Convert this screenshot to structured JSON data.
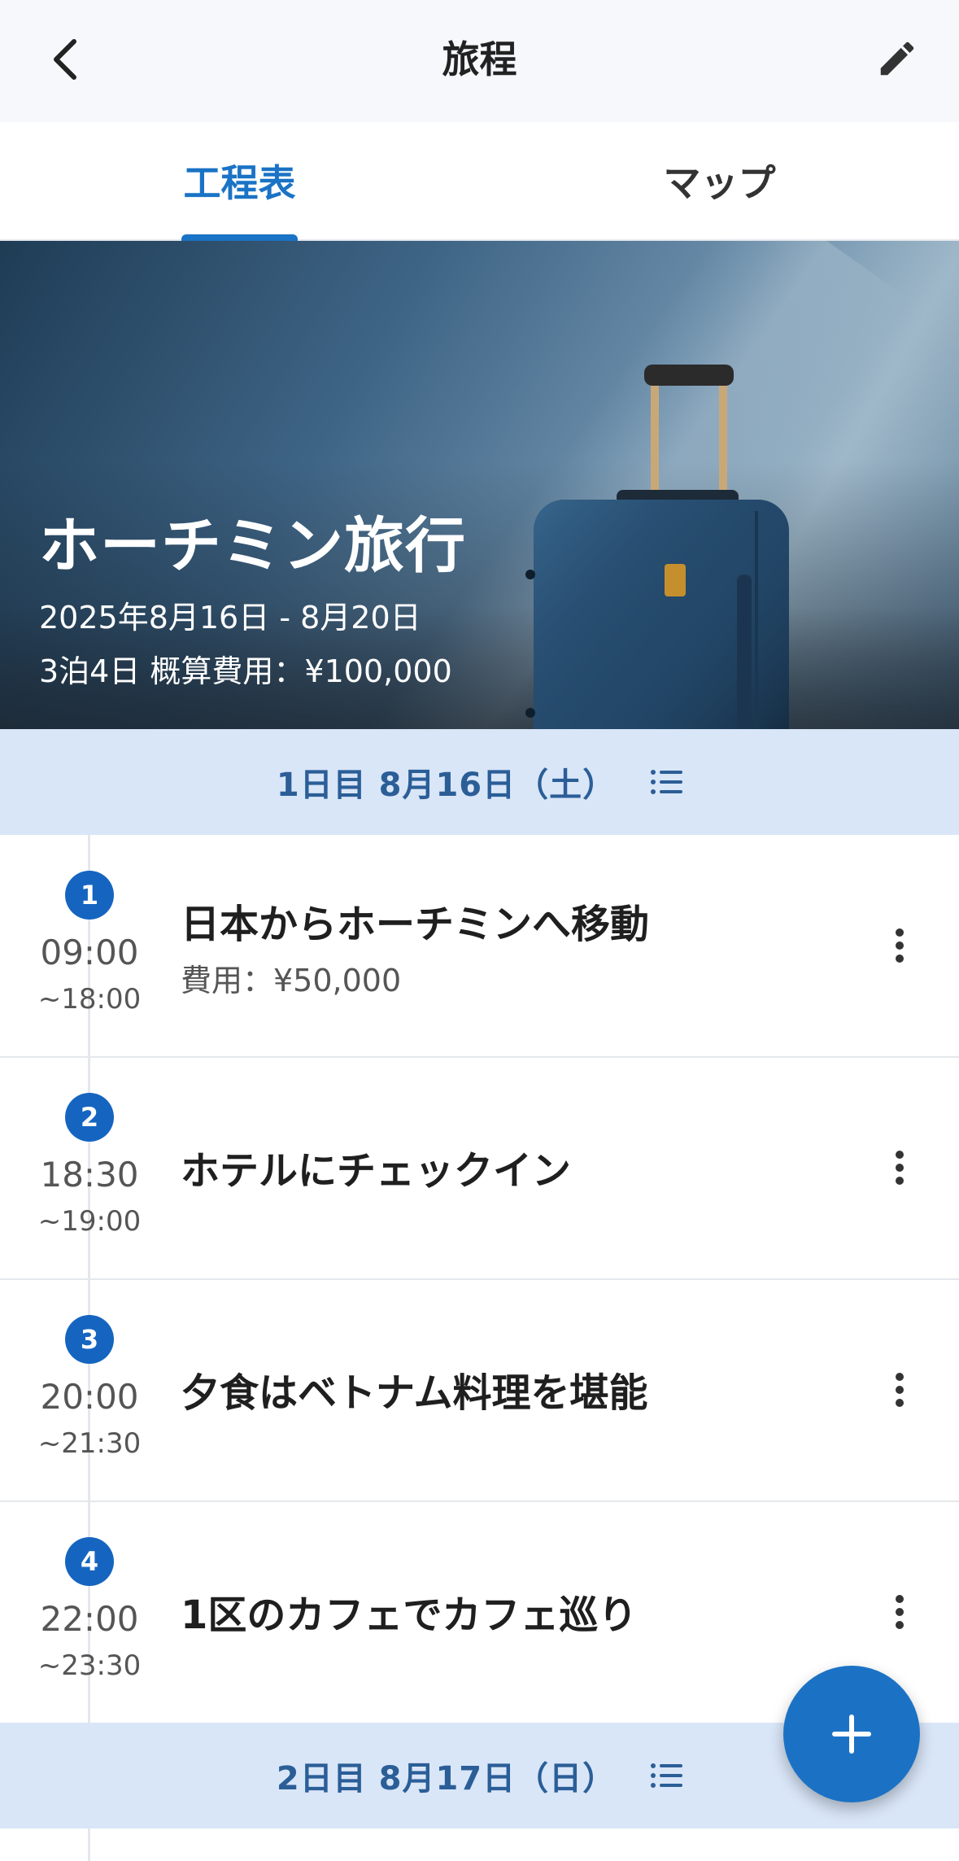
{
  "header": {
    "title": "旅程",
    "back_icon": "chevron-left-icon",
    "edit_icon": "pencil-icon"
  },
  "tabs": [
    {
      "label": "工程表",
      "active": true
    },
    {
      "label": "マップ",
      "active": false
    }
  ],
  "trip": {
    "name": "ホーチミン旅行",
    "dates": "2025年8月16日 - 8月20日",
    "summary": "3泊4日 概算費用：¥100,000"
  },
  "days": [
    {
      "label": "1日目 8月16日（土）",
      "items": [
        {
          "num": "1",
          "start": "09:00",
          "end": "~18:00",
          "title": "日本からホーチミンへ移動",
          "cost": "費用：¥50,000"
        },
        {
          "num": "2",
          "start": "18:30",
          "end": "~19:00",
          "title": "ホテルにチェックイン"
        },
        {
          "num": "3",
          "start": "20:00",
          "end": "~21:30",
          "title": "夕食はベトナム料理を堪能"
        },
        {
          "num": "4",
          "start": "22:00",
          "end": "~23:30",
          "title": "1区のカフェでカフェ巡り"
        }
      ]
    },
    {
      "label": "2日目 8月17日（日）",
      "items": []
    }
  ],
  "colors": {
    "accent": "#1a73c5",
    "day_header_bg": "#d9e6f8",
    "badge": "#1565c0"
  },
  "fab": {
    "icon": "plus-icon"
  }
}
